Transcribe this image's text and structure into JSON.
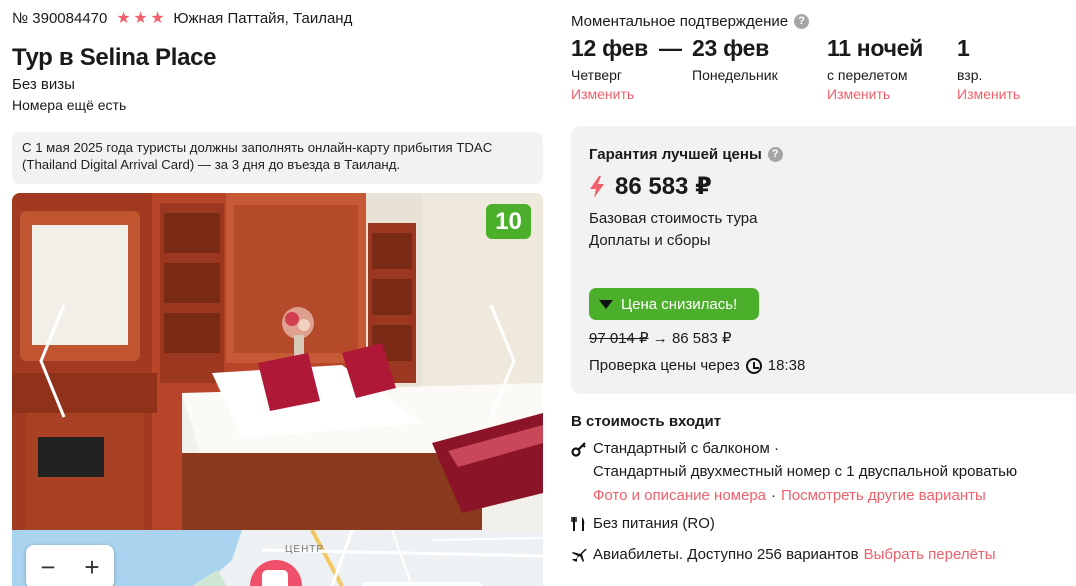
{
  "tour": {
    "id": "№ 390084470",
    "stars": 3,
    "region": "Южная Паттайя, Таиланд",
    "title": "Тур в Selina Place",
    "visa": "Без визы",
    "rooms": "Номера ещё есть",
    "notice": "С 1 мая 2025 года туристы должны заполнять онлайн-карту прибытия TDAC (Thailand Digital Arrival Card) — за 3 дня до въезда в Таиланд."
  },
  "gallery": {
    "rating": "10"
  },
  "map": {
    "label": "ЦЕНТР",
    "zoom_out": "−",
    "zoom_in": "+"
  },
  "trip": {
    "confirm": "Моментальное подтверждение",
    "help": "?",
    "from_date": "12 фев",
    "from_day": "Четверг",
    "dash": "—",
    "to_date": "23 фев",
    "to_day": "Понедельник",
    "nights": "11 ночей",
    "nights_sub": "с перелетом",
    "adults": "1",
    "adults_sub": "взр.",
    "edit": "Изменить"
  },
  "price": {
    "guarantee": "Гарантия лучшей цены",
    "amount": "86 583 ₽",
    "base": "Базовая стоимость тура",
    "surcharges": "Доплаты и сборы",
    "drop_label": "Цена снизилась!",
    "old": "97 014 ₽",
    "arrow": "→",
    "new": "86 583 ₽",
    "check_label": "Проверка цены через",
    "check_time": "18:38"
  },
  "includes": {
    "title": "В стоимость входит",
    "room": "Стандартный с балконом ·",
    "room_desc": "Стандартный двухместный номер с 1 двуспальной кроватью",
    "room_link1": "Фото и описание номера",
    "dot": "·",
    "room_link2": "Посмотреть другие варианты",
    "meal": "Без питания (RO)",
    "flights": "Авиабилеты. Доступно 256 вариантов",
    "flights_link": "Выбрать перелёты"
  },
  "colors": {
    "accent": "#f0606a",
    "green": "#4caf2b",
    "card_bg": "#f2f2f2"
  },
  "icons": [
    "star-icon",
    "help-icon",
    "bolt-icon",
    "triangle-down-icon",
    "clock-icon",
    "key-icon",
    "cutlery-icon",
    "plane-icon",
    "chevron-left-icon",
    "chevron-right-icon"
  ]
}
